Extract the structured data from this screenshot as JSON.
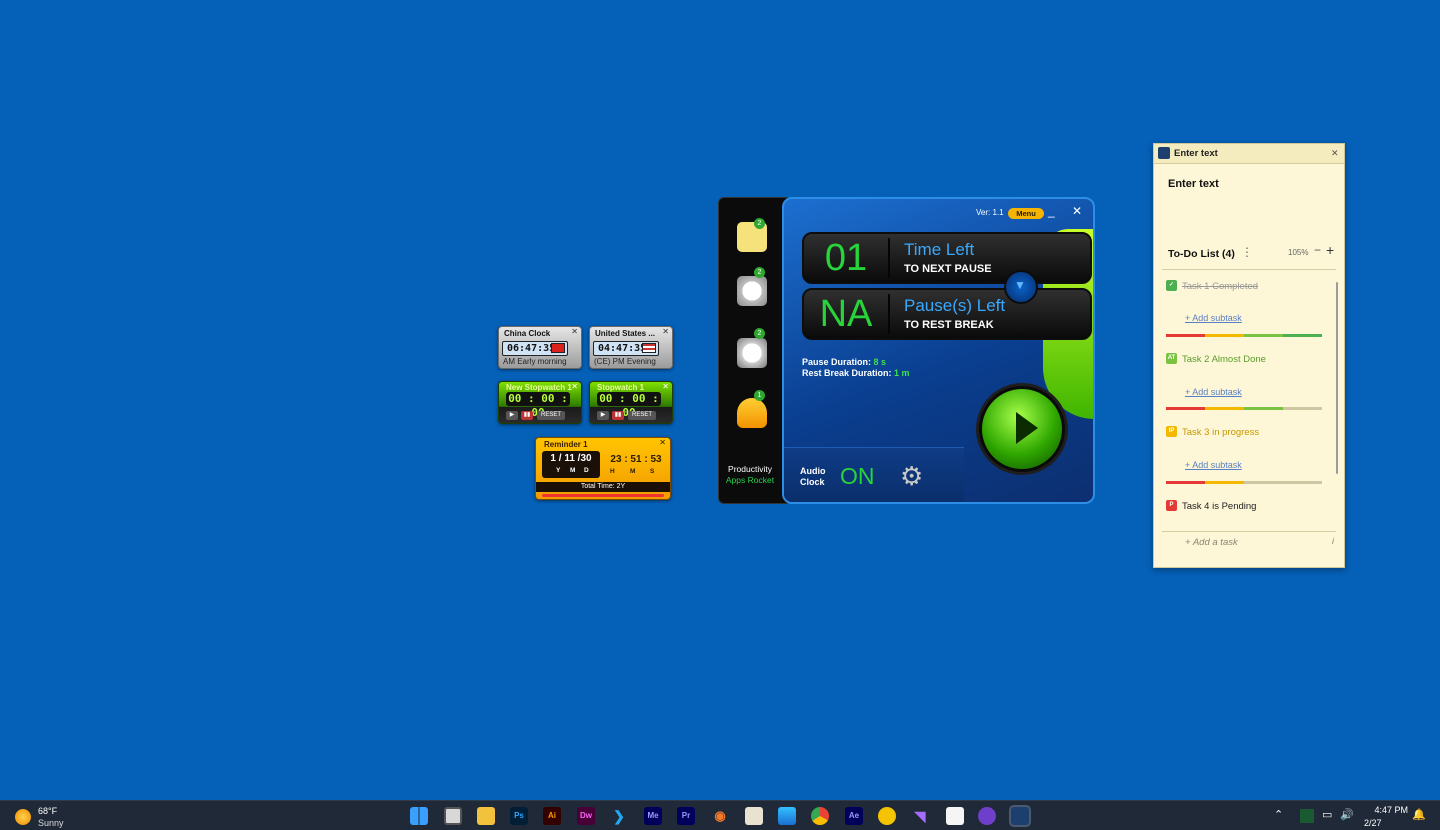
{
  "clocks": [
    {
      "title": "China Clock",
      "time": "06:47:35",
      "sub": "AM Early morning",
      "flag": "china"
    },
    {
      "title": "United States ...",
      "time": "04:47:35",
      "sub": "(CE) PM Evening",
      "flag": "united-states"
    }
  ],
  "stopwatches": [
    {
      "title": "New Stopwatch 1",
      "time": "00 : 00 : 00",
      "reset": "RESET"
    },
    {
      "title": "Stopwatch 1",
      "time": "00 : 00 : 00",
      "reset": "RESET"
    }
  ],
  "reminder": {
    "title": "Reminder 1",
    "date": "1 / 11 /30",
    "date_labels": [
      "Y",
      "M",
      "D"
    ],
    "time": "23 : 51 : 53",
    "time_labels": [
      "H",
      "M",
      "S"
    ],
    "total": "Total Time: 2Y"
  },
  "sidebar": {
    "badges": [
      "2",
      "2",
      "2",
      "1"
    ],
    "brand_line1": "Productivity",
    "brand_line2": "Apps Rocket"
  },
  "timer": {
    "version": "Ver: 1.1",
    "menu": "Menu",
    "minimize": "_",
    "close": "✕",
    "time_left_value": "01",
    "time_left_title": "Time Left",
    "time_left_sub": "TO NEXT PAUSE",
    "pauses_left_value": "NA",
    "pauses_left_title": "Pause(s) Left",
    "pauses_left_sub": "TO REST BREAK",
    "pause_duration_label": "Pause Duration:",
    "pause_duration_value": "8 s",
    "rest_duration_label": "Rest Break Duration:",
    "rest_duration_value": "1 m",
    "audio_line1": "Audio",
    "audio_line2": "Clock",
    "audio_state": "ON"
  },
  "note": {
    "header": "Enter text",
    "body": "Enter text",
    "todo_title": "To-Do List (4)",
    "zoom": "105%",
    "zoom_minus": "−",
    "zoom_plus": "+",
    "tasks": [
      {
        "badge": "✓",
        "label": "Task 1 Completed",
        "color": "#4caf50",
        "status": "completed"
      },
      {
        "badge": "AT",
        "label": "Task 2 Almost Done",
        "color": "#7cc242",
        "status": "almost-done"
      },
      {
        "badge": "IP",
        "label": "Task 3 in progress",
        "color": "#f5b800",
        "status": "in-progress"
      },
      {
        "badge": "P",
        "label": "Task 4 is Pending",
        "color": "#e53935",
        "status": "pending"
      }
    ],
    "add_subtask": "+ Add subtask",
    "add_task": "+ Add a task",
    "info": "i"
  },
  "taskbar": {
    "temperature": "68°F",
    "condition": "Sunny",
    "apps": [
      "Start",
      "Task View",
      "File Explorer",
      "Ps",
      "Ai",
      "Dw",
      "VS Code",
      "Me",
      "Pr",
      "Blender",
      "Notepad",
      "Photos",
      "Chrome",
      "Ae",
      "Maps",
      "Visual Studio",
      "Docs",
      "GitHub",
      "Productivity Apps"
    ],
    "clock": "4:47 PM",
    "date": "2/27"
  },
  "colors": {
    "desktop": "#0560b8",
    "accent_green": "#27d43a",
    "accent_blue": "#38a9ff"
  }
}
